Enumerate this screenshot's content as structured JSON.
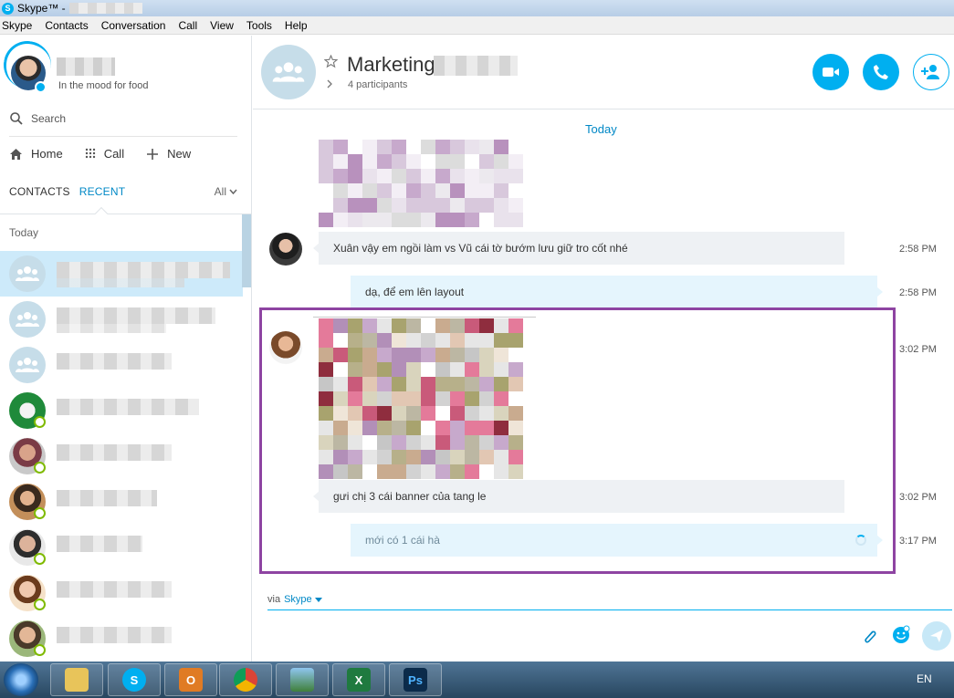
{
  "window": {
    "title": "Skype™ -",
    "app_icon_letter": "S"
  },
  "menu": [
    "Skype",
    "Contacts",
    "Conversation",
    "Call",
    "View",
    "Tools",
    "Help"
  ],
  "profile": {
    "mood": "In the mood for food"
  },
  "sidebar": {
    "search_label": "Search",
    "nav": {
      "home": "Home",
      "call": "Call",
      "new": "New"
    },
    "tabs": {
      "contacts": "CONTACTS",
      "recent": "RECENT",
      "filter": "All"
    },
    "section_today": "Today"
  },
  "conversation": {
    "title": "Marketing",
    "participants": "4 participants",
    "day_separator": "Today",
    "messages": [
      {
        "text": "Xuân vậy em ngồi làm vs Vũ cái tờ bướm lưu giữ tro cốt nhé",
        "time": "2:58 PM",
        "direction": "in"
      },
      {
        "text": "dạ, để em lên layout",
        "time": "2:58 PM",
        "direction": "out"
      },
      {
        "text": "",
        "time": "3:02 PM",
        "direction": "in",
        "kind": "image"
      },
      {
        "text": "gưi chị 3 cái banner của tang le",
        "time": "3:02 PM",
        "direction": "in"
      },
      {
        "text": "mới có 1 cái hà",
        "time": "3:17 PM",
        "direction": "out",
        "status": "sending"
      }
    ],
    "via_label": "via",
    "via_link": "Skype"
  },
  "taskbar": {
    "language": "EN"
  },
  "colors": {
    "accent": "#00aff0",
    "link": "#0088c6",
    "highlight_box": "#8e44a2",
    "presence": "#7fba00"
  }
}
